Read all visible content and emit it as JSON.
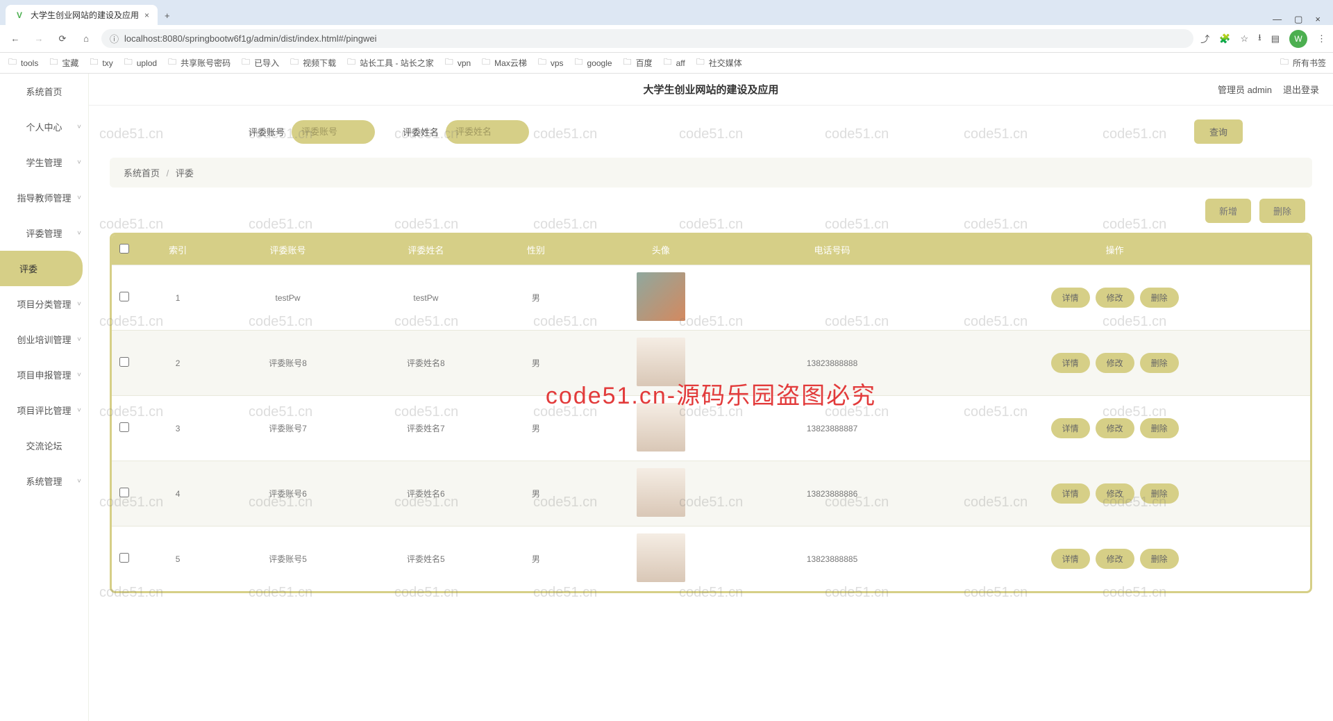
{
  "browser": {
    "tab_title": "大学生创业网站的建设及应用",
    "favicon_letter": "V",
    "url": "localhost:8080/springbootw6f1g/admin/dist/index.html#/pingwei",
    "profile_letter": "W"
  },
  "bookmarks": [
    "tools",
    "宝藏",
    "txy",
    "uplod",
    "共享账号密码",
    "已导入",
    "视频下载",
    "站长工具 - 站长之家",
    "vpn",
    "Max云梯",
    "vps",
    "google",
    "百度",
    "aff",
    "社交媒体"
  ],
  "bookmarks_right": "所有书签",
  "header": {
    "title": "大学生创业网站的建设及应用",
    "user_label": "管理员 admin",
    "logout": "退出登录"
  },
  "sidebar": [
    {
      "label": "系统首页",
      "children": false
    },
    {
      "label": "个人中心",
      "children": true
    },
    {
      "label": "学生管理",
      "children": true
    },
    {
      "label": "指导教师管理",
      "children": true
    },
    {
      "label": "评委管理",
      "children": true
    },
    {
      "label": "评委",
      "children": false,
      "active": true,
      "sub": true
    },
    {
      "label": "项目分类管理",
      "children": true
    },
    {
      "label": "创业培训管理",
      "children": true
    },
    {
      "label": "项目申报管理",
      "children": true
    },
    {
      "label": "项目评比管理",
      "children": true
    },
    {
      "label": "交流论坛",
      "children": false
    },
    {
      "label": "系统管理",
      "children": true
    }
  ],
  "search": {
    "field1_label": "评委账号",
    "field1_placeholder": "评委账号",
    "field2_label": "评委姓名",
    "field2_placeholder": "评委姓名",
    "button": "查询"
  },
  "breadcrumb": {
    "home": "系统首页",
    "current": "评委"
  },
  "actions": {
    "add": "新增",
    "delete": "删除"
  },
  "table": {
    "columns": [
      "",
      "索引",
      "评委账号",
      "评委姓名",
      "性别",
      "头像",
      "电话号码",
      "操作"
    ],
    "row_buttons": {
      "detail": "详情",
      "edit": "修改",
      "delete": "删除"
    },
    "rows": [
      {
        "index": "1",
        "account": "testPw",
        "name": "testPw",
        "gender": "男",
        "phone": ""
      },
      {
        "index": "2",
        "account": "评委账号8",
        "name": "评委姓名8",
        "gender": "男",
        "phone": "13823888888"
      },
      {
        "index": "3",
        "account": "评委账号7",
        "name": "评委姓名7",
        "gender": "男",
        "phone": "13823888887"
      },
      {
        "index": "4",
        "account": "评委账号6",
        "name": "评委姓名6",
        "gender": "男",
        "phone": "13823888886"
      },
      {
        "index": "5",
        "account": "评委账号5",
        "name": "评委姓名5",
        "gender": "男",
        "phone": "13823888885"
      }
    ]
  },
  "watermarks": {
    "small": "code51.cn",
    "big": "code51.cn-源码乐园盗图必究"
  }
}
